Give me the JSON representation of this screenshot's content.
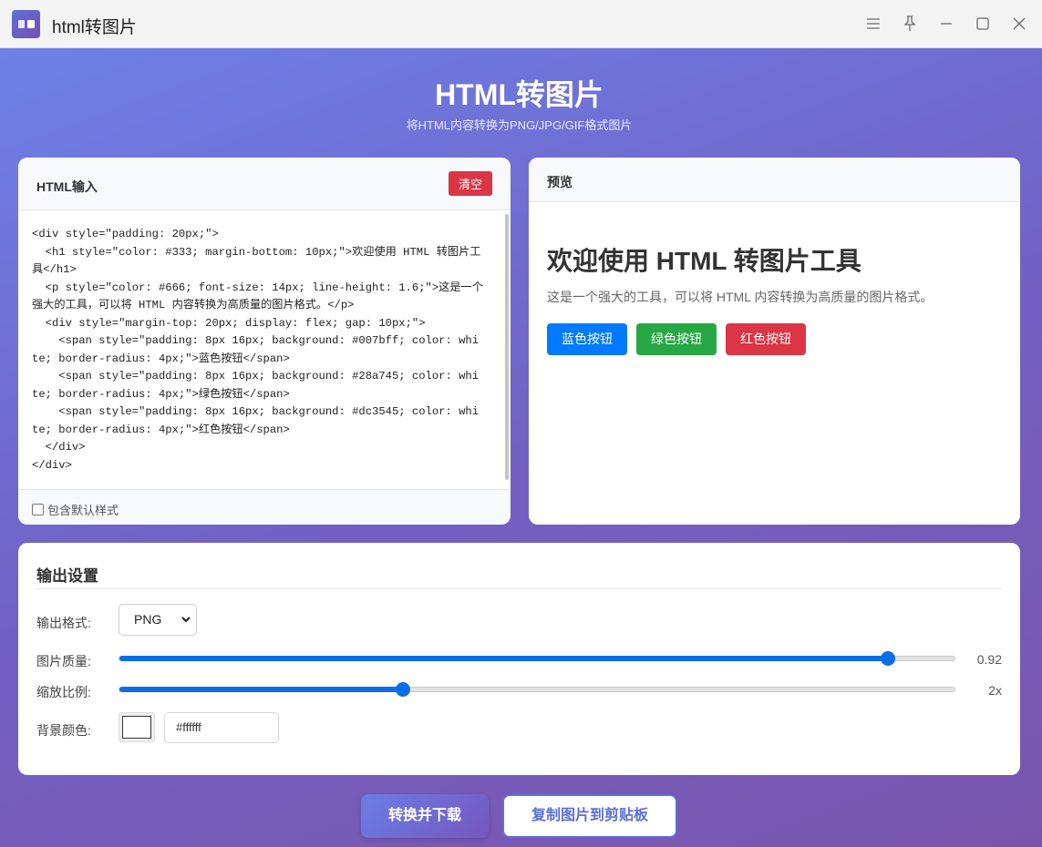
{
  "window": {
    "title": "html转图片",
    "controls": [
      "menu-icon",
      "pin-icon",
      "minimize-icon",
      "maximize-icon",
      "close-icon"
    ]
  },
  "header": {
    "title": "HTML转图片",
    "subtitle": "将HTML内容转换为PNG/JPG/GIF格式图片"
  },
  "input_panel": {
    "label": "HTML输入",
    "clear_label": "清空",
    "code": "<div style=\"padding: 20px;\">\n  <h1 style=\"color: #333; margin-bottom: 10px;\">欢迎使用 HTML 转图片工具</h1>\n  <p style=\"color: #666; font-size: 14px; line-height: 1.6;\">这是一个强大的工具，可以将 HTML 内容转换为高质量的图片格式。</p>\n  <div style=\"margin-top: 20px; display: flex; gap: 10px;\">\n    <span style=\"padding: 8px 16px; background: #007bff; color: white; border-radius: 4px;\">蓝色按钮</span>\n    <span style=\"padding: 8px 16px; background: #28a745; color: white; border-radius: 4px;\">绿色按钮</span>\n    <span style=\"padding: 8px 16px; background: #dc3545; color: white; border-radius: 4px;\">红色按钮</span>\n  </div>\n</div>",
    "include_default_styles_label": "包含默认样式",
    "include_default_styles_checked": false
  },
  "preview_panel": {
    "label": "预览",
    "heading": "欢迎使用 HTML 转图片工具",
    "paragraph": "这是一个强大的工具，可以将 HTML 内容转换为高质量的图片格式。",
    "buttons": [
      {
        "label": "蓝色按钮",
        "color": "#007bff"
      },
      {
        "label": "绿色按钮",
        "color": "#28a745"
      },
      {
        "label": "红色按钮",
        "color": "#dc3545"
      }
    ]
  },
  "settings": {
    "title": "输出设置",
    "format_label": "输出格式:",
    "format_value": "PNG",
    "quality_label": "图片质量:",
    "quality_value": "0.92",
    "quality_fraction": 0.92,
    "scale_label": "缩放比例:",
    "scale_value": "2x",
    "scale_fraction": 0.34,
    "bg_label": "背景颜色:",
    "bg_value": "#ffffff"
  },
  "actions": {
    "convert_label": "转换并下载",
    "copy_label": "复制图片到剪贴板"
  },
  "colors": {
    "accent": "#0a6fe6",
    "danger": "#dc3545",
    "brand": "#5b6fd6"
  }
}
